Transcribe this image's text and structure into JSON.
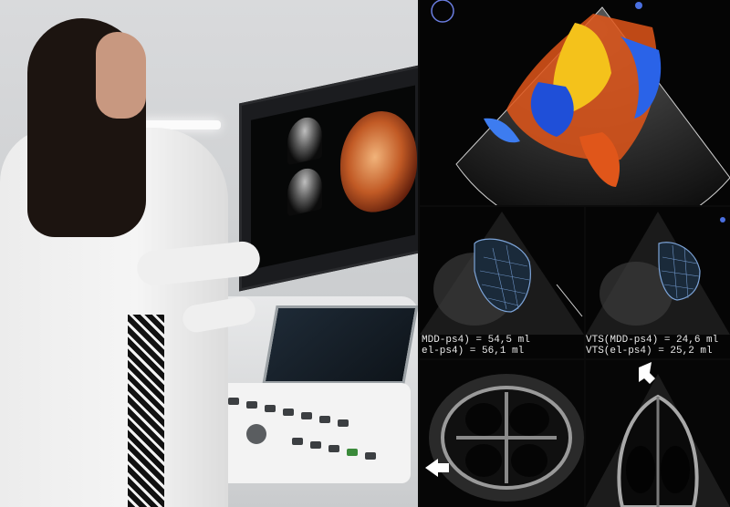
{
  "echo_panels": {
    "left_readout": {
      "line1": "MDD-ps4) = 54,5 ml",
      "line2": "el-ps4) = 56,1 ml"
    },
    "right_readout": {
      "line1": "VTS(MDD-ps4) = 24,6 ml",
      "line2": "VTS(el-ps4) = 25,2 ml"
    }
  },
  "colors": {
    "doppler_blue": "#1f4fd8",
    "doppler_yellow": "#f4c21b",
    "doppler_red": "#e0561a",
    "arrow_white": "#ffffff"
  },
  "icons": [
    "arrow-icon",
    "arrow-icon"
  ]
}
